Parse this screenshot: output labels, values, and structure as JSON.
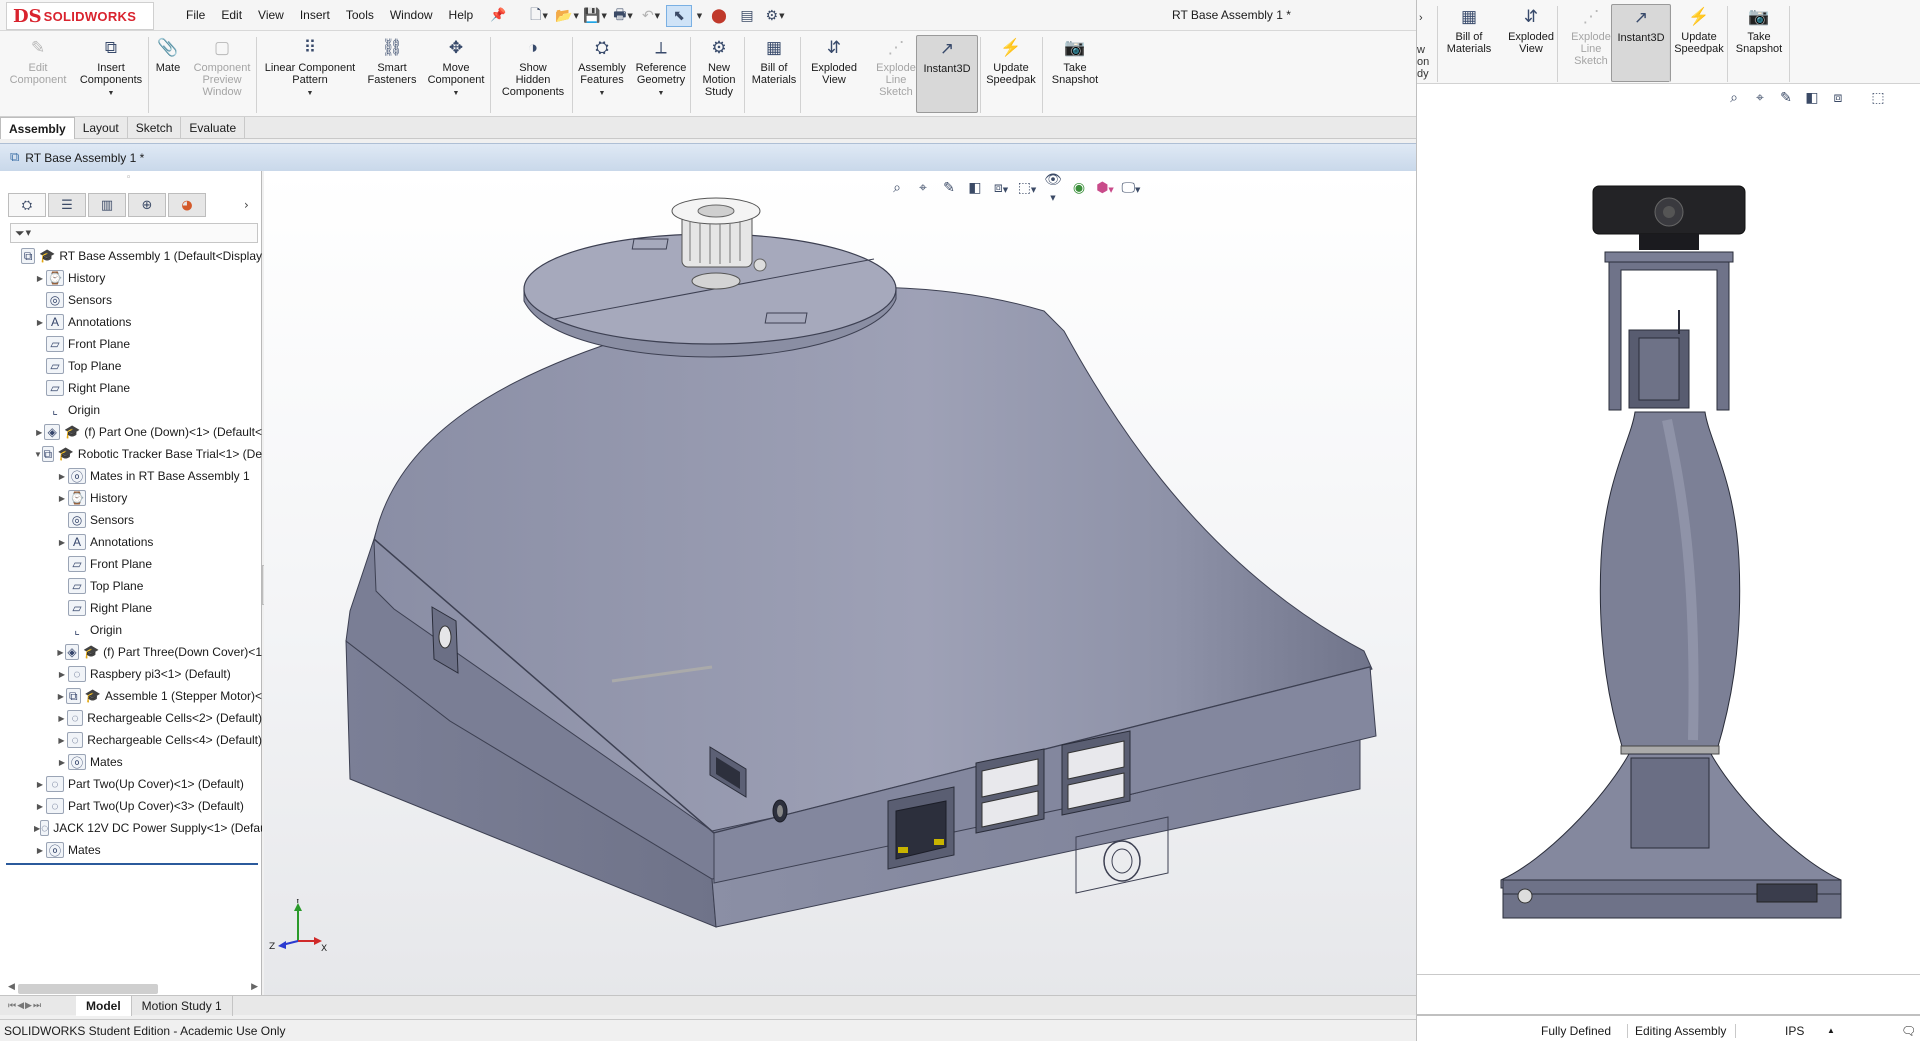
{
  "app": {
    "logo_mark": "DS",
    "logo_text": "SOLIDWORKS",
    "document_title": "RT Base Assembly 1 *"
  },
  "menu": [
    "File",
    "Edit",
    "View",
    "Insert",
    "Tools",
    "Window",
    "Help"
  ],
  "command_manager": {
    "buttons": [
      {
        "id": "edit-component",
        "label_lines": [
          "Edit",
          "Component"
        ],
        "icon": "edit-component-icon",
        "disabled": true
      },
      {
        "id": "insert-components",
        "label_lines": [
          "Insert",
          "Components"
        ],
        "icon": "insert-components-icon",
        "disabled": false,
        "dropdown": true
      },
      {
        "id": "mate",
        "label_lines": [
          "Mate"
        ],
        "icon": "paperclip-icon",
        "disabled": false
      },
      {
        "id": "component-preview-window",
        "label_lines": [
          "Component",
          "Preview",
          "Window"
        ],
        "icon": "preview-window-icon",
        "disabled": true
      },
      {
        "id": "linear-component-pattern",
        "label_lines": [
          "Linear Component",
          "Pattern"
        ],
        "icon": "linear-pattern-icon",
        "disabled": false,
        "dropdown": true
      },
      {
        "id": "smart-fasteners",
        "label_lines": [
          "Smart",
          "Fasteners"
        ],
        "icon": "smart-fasteners-icon",
        "disabled": false
      },
      {
        "id": "move-component",
        "label_lines": [
          "Move",
          "Component"
        ],
        "icon": "move-component-icon",
        "disabled": false,
        "dropdown": true
      },
      {
        "id": "show-hidden-components",
        "label_lines": [
          "Show",
          "Hidden",
          "Components"
        ],
        "icon": "show-hidden-icon",
        "disabled": false
      },
      {
        "id": "assembly-features",
        "label_lines": [
          "Assembly",
          "Features"
        ],
        "icon": "assembly-features-icon",
        "disabled": false,
        "dropdown": true
      },
      {
        "id": "reference-geometry",
        "label_lines": [
          "Reference",
          "Geometry"
        ],
        "icon": "reference-geometry-icon",
        "disabled": false,
        "dropdown": true
      },
      {
        "id": "new-motion-study",
        "label_lines": [
          "New",
          "Motion",
          "Study"
        ],
        "icon": "motion-study-icon",
        "disabled": false
      },
      {
        "id": "bill-of-materials",
        "label_lines": [
          "Bill of",
          "Materials"
        ],
        "icon": "bill-of-materials-icon",
        "disabled": false
      },
      {
        "id": "exploded-view",
        "label_lines": [
          "Exploded",
          "View"
        ],
        "icon": "exploded-view-icon",
        "disabled": false
      },
      {
        "id": "explode-line-sketch",
        "label_lines": [
          "Explode",
          "Line",
          "Sketch"
        ],
        "icon": "explode-line-sketch-icon",
        "disabled": true
      },
      {
        "id": "instant3d",
        "label_lines": [
          "Instant3D"
        ],
        "icon": "instant3d-icon",
        "disabled": false,
        "selected": true
      },
      {
        "id": "update-speedpak",
        "label_lines": [
          "Update",
          "Speedpak"
        ],
        "icon": "speedpak-icon",
        "disabled": false
      },
      {
        "id": "take-snapshot",
        "label_lines": [
          "Take",
          "Snapshot"
        ],
        "icon": "camera-icon",
        "disabled": false
      }
    ]
  },
  "tabs": [
    "Assembly",
    "Layout",
    "Sketch",
    "Evaluate"
  ],
  "active_tab": "Assembly",
  "tree": [
    {
      "text": "RT Base Assembly 1  (Default<Display",
      "level": 0,
      "toggle": "",
      "icon": "assembly-icon"
    },
    {
      "text": "History",
      "level": 1,
      "toggle": "▶",
      "icon": "history-icon"
    },
    {
      "text": "Sensors",
      "level": 1,
      "toggle": "",
      "icon": "sensors-icon"
    },
    {
      "text": "Annotations",
      "level": 1,
      "toggle": "▶",
      "icon": "annotations-icon"
    },
    {
      "text": "Front Plane",
      "level": 1,
      "toggle": "",
      "icon": "plane-icon"
    },
    {
      "text": "Top Plane",
      "level": 1,
      "toggle": "",
      "icon": "plane-icon"
    },
    {
      "text": "Right Plane",
      "level": 1,
      "toggle": "",
      "icon": "plane-icon"
    },
    {
      "text": "Origin",
      "level": 1,
      "toggle": "",
      "icon": "origin-icon"
    },
    {
      "text": "(f) Part One (Down)<1> (Default<",
      "level": 1,
      "toggle": "▶",
      "icon": "part-icon"
    },
    {
      "text": "Robotic Tracker Base Trial<1> (De",
      "level": 1,
      "toggle": "▼",
      "icon": "subassembly-icon"
    },
    {
      "text": "Mates in RT Base Assembly 1",
      "level": 2,
      "toggle": "▶",
      "icon": "mates-icon"
    },
    {
      "text": "History",
      "level": 2,
      "toggle": "▶",
      "icon": "history-icon"
    },
    {
      "text": "Sensors",
      "level": 2,
      "toggle": "",
      "icon": "sensors-icon"
    },
    {
      "text": "Annotations",
      "level": 2,
      "toggle": "▶",
      "icon": "annotations-icon"
    },
    {
      "text": "Front Plane",
      "level": 2,
      "toggle": "",
      "icon": "plane-icon"
    },
    {
      "text": "Top Plane",
      "level": 2,
      "toggle": "",
      "icon": "plane-icon"
    },
    {
      "text": "Right Plane",
      "level": 2,
      "toggle": "",
      "icon": "plane-icon"
    },
    {
      "text": "Origin",
      "level": 2,
      "toggle": "",
      "icon": "origin-icon"
    },
    {
      "text": "(f) Part Three(Down Cover)<1",
      "level": 2,
      "toggle": "▶",
      "icon": "part-icon"
    },
    {
      "text": "Raspbery pi3<1> (Default)",
      "level": 2,
      "toggle": "▶",
      "icon": "component-icon"
    },
    {
      "text": "Assemble 1 (Stepper Motor)<",
      "level": 2,
      "toggle": "▶",
      "icon": "subassembly-icon"
    },
    {
      "text": "Rechargeable Cells<2> (Default)",
      "level": 2,
      "toggle": "▶",
      "icon": "component-icon"
    },
    {
      "text": "Rechargeable Cells<4> (Default)",
      "level": 2,
      "toggle": "▶",
      "icon": "component-icon"
    },
    {
      "text": "Mates",
      "level": 2,
      "toggle": "▶",
      "icon": "mates-icon"
    },
    {
      "text": "Part Two(Up Cover)<1> (Default)",
      "level": 1,
      "toggle": "▶",
      "icon": "component-icon"
    },
    {
      "text": "Part Two(Up Cover)<3> (Default)",
      "level": 1,
      "toggle": "▶",
      "icon": "component-icon"
    },
    {
      "text": "JACK 12V DC Power Supply<1> (Defau",
      "level": 1,
      "toggle": "▶",
      "icon": "component-icon"
    },
    {
      "text": "Mates",
      "level": 1,
      "toggle": "▶",
      "icon": "mates-icon"
    }
  ],
  "bottom_tabs": [
    "Model",
    "Motion Study 1"
  ],
  "active_bottom_tab": "Model",
  "status": {
    "left": "SOLIDWORKS Student Edition - Academic Use Only",
    "state": "Fully Defined",
    "mode": "Editing Assembly",
    "units": "IPS"
  },
  "triad": {
    "x": "X",
    "y": "Y",
    "z": "Z"
  },
  "side_window": {
    "cutoff_lines": [
      "w",
      "on",
      "dy"
    ],
    "buttons": [
      {
        "id": "bill-of-materials",
        "label_lines": [
          "Bill of",
          "Materials"
        ],
        "icon": "bill-of-materials-icon",
        "disabled": false
      },
      {
        "id": "exploded-view",
        "label_lines": [
          "Exploded",
          "View"
        ],
        "icon": "exploded-view-icon",
        "disabled": false
      },
      {
        "id": "explode-line-sketch",
        "label_lines": [
          "Explode",
          "Line",
          "Sketch"
        ],
        "icon": "explode-line-sketch-icon",
        "disabled": true
      },
      {
        "id": "instant3d",
        "label_lines": [
          "Instant3D"
        ],
        "icon": "instant3d-icon",
        "disabled": false,
        "selected": true
      },
      {
        "id": "update-speedpak",
        "label_lines": [
          "Update",
          "Speedpak"
        ],
        "icon": "speedpak-icon",
        "disabled": false
      },
      {
        "id": "take-snapshot",
        "label_lines": [
          "Take",
          "Snapshot"
        ],
        "icon": "camera-icon",
        "disabled": false
      }
    ]
  },
  "colors": {
    "model_body": "#7d8197",
    "model_dark": "#5e6278",
    "model_light": "#9a9db1",
    "accent": "#2b5a9c",
    "brand_red": "#d9232e"
  }
}
